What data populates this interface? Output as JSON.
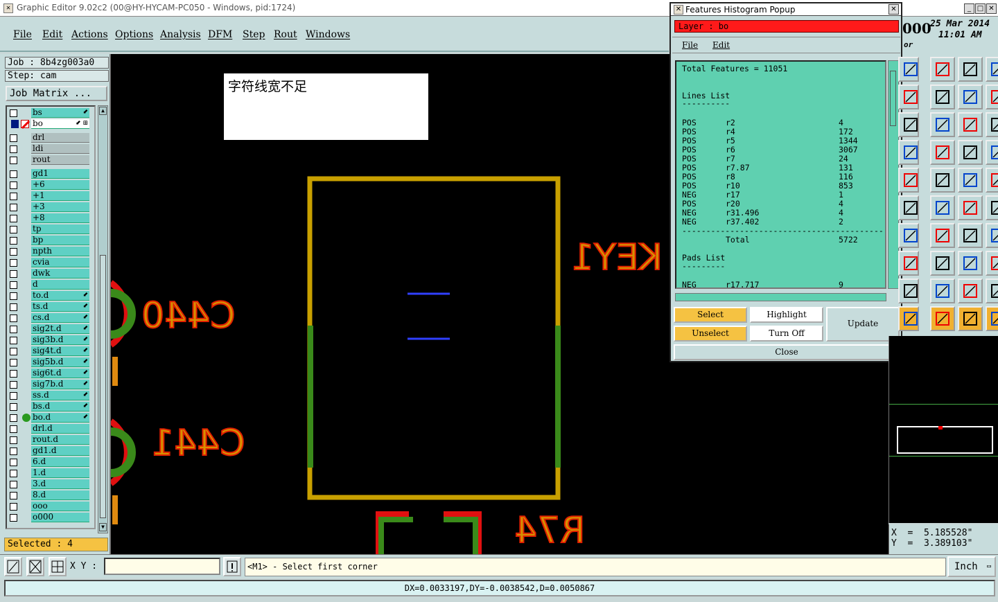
{
  "window": {
    "title": "Graphic Editor 9.02c2 (00@HY-HYCAM-PC050 - Windows, pid:1724)",
    "date_partial": "000",
    "date": "25 Mar 2014",
    "time": "11:01 AM",
    "or_label": "or"
  },
  "menu": [
    "File",
    "Edit",
    "Actions",
    "Options",
    "Analysis",
    "DFM",
    "Step",
    "Rout",
    "Windows"
  ],
  "job": {
    "job_label": "Job : 8b4zg003a0",
    "step_label": "Step: cam",
    "matrix_button": "Job Matrix ..."
  },
  "layers": [
    {
      "name": "bs",
      "mark": "⬋"
    },
    {
      "name": "bo",
      "mark": "⬋ ⊞",
      "selected": true
    },
    {
      "name": "drl",
      "grey": true
    },
    {
      "name": "ldi",
      "grey": true
    },
    {
      "name": "rout",
      "grey": true
    },
    {
      "name": "gd1"
    },
    {
      "name": "+6"
    },
    {
      "name": "+1"
    },
    {
      "name": "+3"
    },
    {
      "name": "+8"
    },
    {
      "name": "tp"
    },
    {
      "name": "bp"
    },
    {
      "name": "npth"
    },
    {
      "name": "cvia"
    },
    {
      "name": "dwk"
    },
    {
      "name": "d"
    },
    {
      "name": "to.d",
      "mark": "⬋"
    },
    {
      "name": "ts.d",
      "mark": "⬋"
    },
    {
      "name": "cs.d",
      "mark": "⬋"
    },
    {
      "name": "sig2t.d",
      "mark": "⬋"
    },
    {
      "name": "sig3b.d",
      "mark": "⬋"
    },
    {
      "name": "sig4t.d",
      "mark": "⬋"
    },
    {
      "name": "sig5b.d",
      "mark": "⬋"
    },
    {
      "name": "sig6t.d",
      "mark": "⬋"
    },
    {
      "name": "sig7b.d",
      "mark": "⬋"
    },
    {
      "name": "ss.d",
      "mark": "⬋"
    },
    {
      "name": "bs.d",
      "mark": "⬋"
    },
    {
      "name": "bo.d",
      "mark": "⬋"
    },
    {
      "name": "drl.d"
    },
    {
      "name": "rout.d"
    },
    {
      "name": "gd1.d"
    },
    {
      "name": "6.d"
    },
    {
      "name": "1.d"
    },
    {
      "name": "3.d"
    },
    {
      "name": "8.d"
    },
    {
      "name": "ooo"
    },
    {
      "name": "o000"
    }
  ],
  "selected_text": "Selected : 4",
  "canvas": {
    "note": "字符线宽不足",
    "labels": {
      "c440": "C440",
      "c441": "C441",
      "key1": "KEY1",
      "r74": "R74"
    }
  },
  "bottom": {
    "xy_label": "X Y :",
    "prompt": "<M1> - Select first corner",
    "unit": "Inch",
    "status": "DX=0.0033197,DY=-0.0038542,D=0.0050867"
  },
  "coords": {
    "x": "X  =  5.185528\"",
    "y": "Y  =  3.389103\""
  },
  "popup": {
    "title": "Features Histogram Popup",
    "layer": "Layer :  bo",
    "menu": [
      "File",
      "Edit"
    ],
    "total": "Total Features = 11051",
    "lines_header": "Lines List",
    "underline": "----------",
    "lines": [
      {
        "pol": "POS",
        "sym": "r2",
        "count": "4"
      },
      {
        "pol": "POS",
        "sym": "r4",
        "count": "172"
      },
      {
        "pol": "POS",
        "sym": "r5",
        "count": "1344"
      },
      {
        "pol": "POS",
        "sym": "r6",
        "count": "3067"
      },
      {
        "pol": "POS",
        "sym": "r7",
        "count": "24"
      },
      {
        "pol": "POS",
        "sym": "r7.87",
        "count": "131"
      },
      {
        "pol": "POS",
        "sym": "r8",
        "count": "116"
      },
      {
        "pol": "POS",
        "sym": "r10",
        "count": "853"
      },
      {
        "pol": "NEG",
        "sym": "r17",
        "count": "1"
      },
      {
        "pol": "POS",
        "sym": "r20",
        "count": "4"
      },
      {
        "pol": "NEG",
        "sym": "r31.496",
        "count": "4"
      },
      {
        "pol": "NEG",
        "sym": "r37.402",
        "count": "2"
      }
    ],
    "separator": "------------------------------------------",
    "total_label": "Total",
    "total_value": "5722",
    "pads_header": "Pads List",
    "pads_underline": "---------",
    "pads": [
      {
        "pol": "NEG",
        "sym": "r17.717",
        "count": "9"
      }
    ],
    "buttons": {
      "select": "Select",
      "highlight": "Highlight",
      "update": "Update",
      "unselect": "Unselect",
      "turnoff": "Turn Off",
      "close": "Close"
    }
  }
}
